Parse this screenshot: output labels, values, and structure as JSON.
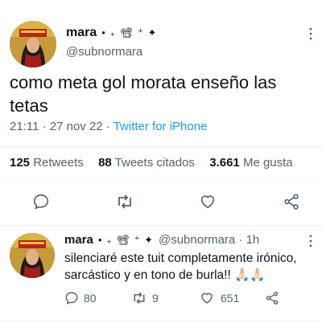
{
  "colors": {
    "link": "#1d9bf0",
    "muted": "#536471",
    "text": "#0f1419",
    "divider": "#eff3f4"
  },
  "main_tweet": {
    "display_name": "mara",
    "name_decoration": "• ₊ 📽 ⁺ ✦",
    "handle": "@subnormara",
    "text": "como meta gol morata enseño las tetas",
    "time": "21:11 · 27 nov 22 · ",
    "source": "Twitter for iPhone",
    "stats": {
      "retweets_count": "125",
      "retweets_label": "Retweets",
      "quotes_count": "88",
      "quotes_label": "Tweets citados",
      "likes_count": "3.661",
      "likes_label": "Me gusta"
    },
    "actions": [
      "reply-icon",
      "retweet-icon",
      "like-icon",
      "share-icon"
    ]
  },
  "reply_tweet": {
    "display_name": "mara",
    "name_decoration": "• ₊ 📽 ⁺ ✦",
    "handle_time": "@subnormara · 1h",
    "text": "silenciaré este tuit completamente irónico, sarcástico y en tono de burla!! 🙏🏻🙏🏻",
    "reply_count": "80",
    "retweet_count": "9",
    "like_count": "651"
  }
}
